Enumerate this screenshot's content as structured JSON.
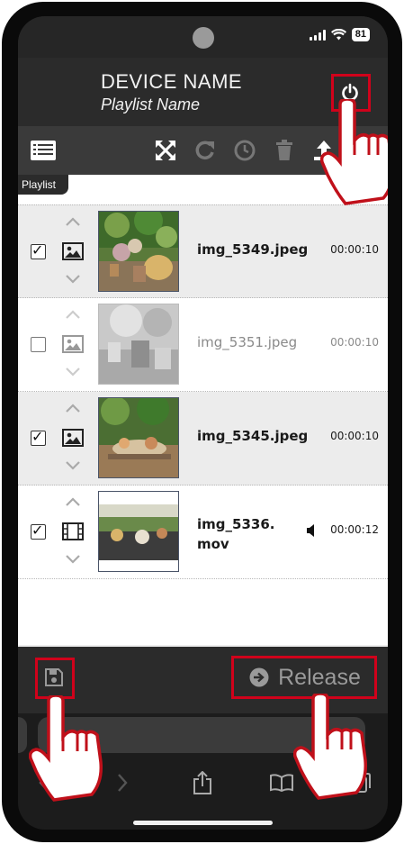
{
  "status_bar": {
    "battery": "81"
  },
  "header": {
    "device_name": "DEVICE NAME",
    "playlist_name": "Playlist Name"
  },
  "toolbar": {
    "icons": [
      "list-icon",
      "fullscreen-icon",
      "redo-icon",
      "clock-icon",
      "trash-icon",
      "upload-icon"
    ]
  },
  "playlist_tab": "Playlist",
  "items": [
    {
      "file": "img_5349.jpeg",
      "duration": "00:00:10",
      "checked": true,
      "type": "image"
    },
    {
      "file": "img_5351.jpeg",
      "duration": "00:00:10",
      "checked": false,
      "type": "image"
    },
    {
      "file": "img_5345.jpeg",
      "duration": "00:00:10",
      "checked": true,
      "type": "image"
    },
    {
      "file": "img_5336.mov",
      "duration": "00:00:12",
      "checked": true,
      "type": "video"
    }
  ],
  "bottom_bar": {
    "release_label": "Release"
  },
  "colors": {
    "highlight": "#d0021b",
    "header_bg": "#2b2b2b",
    "toolbar_bg": "#3a3a3a"
  }
}
